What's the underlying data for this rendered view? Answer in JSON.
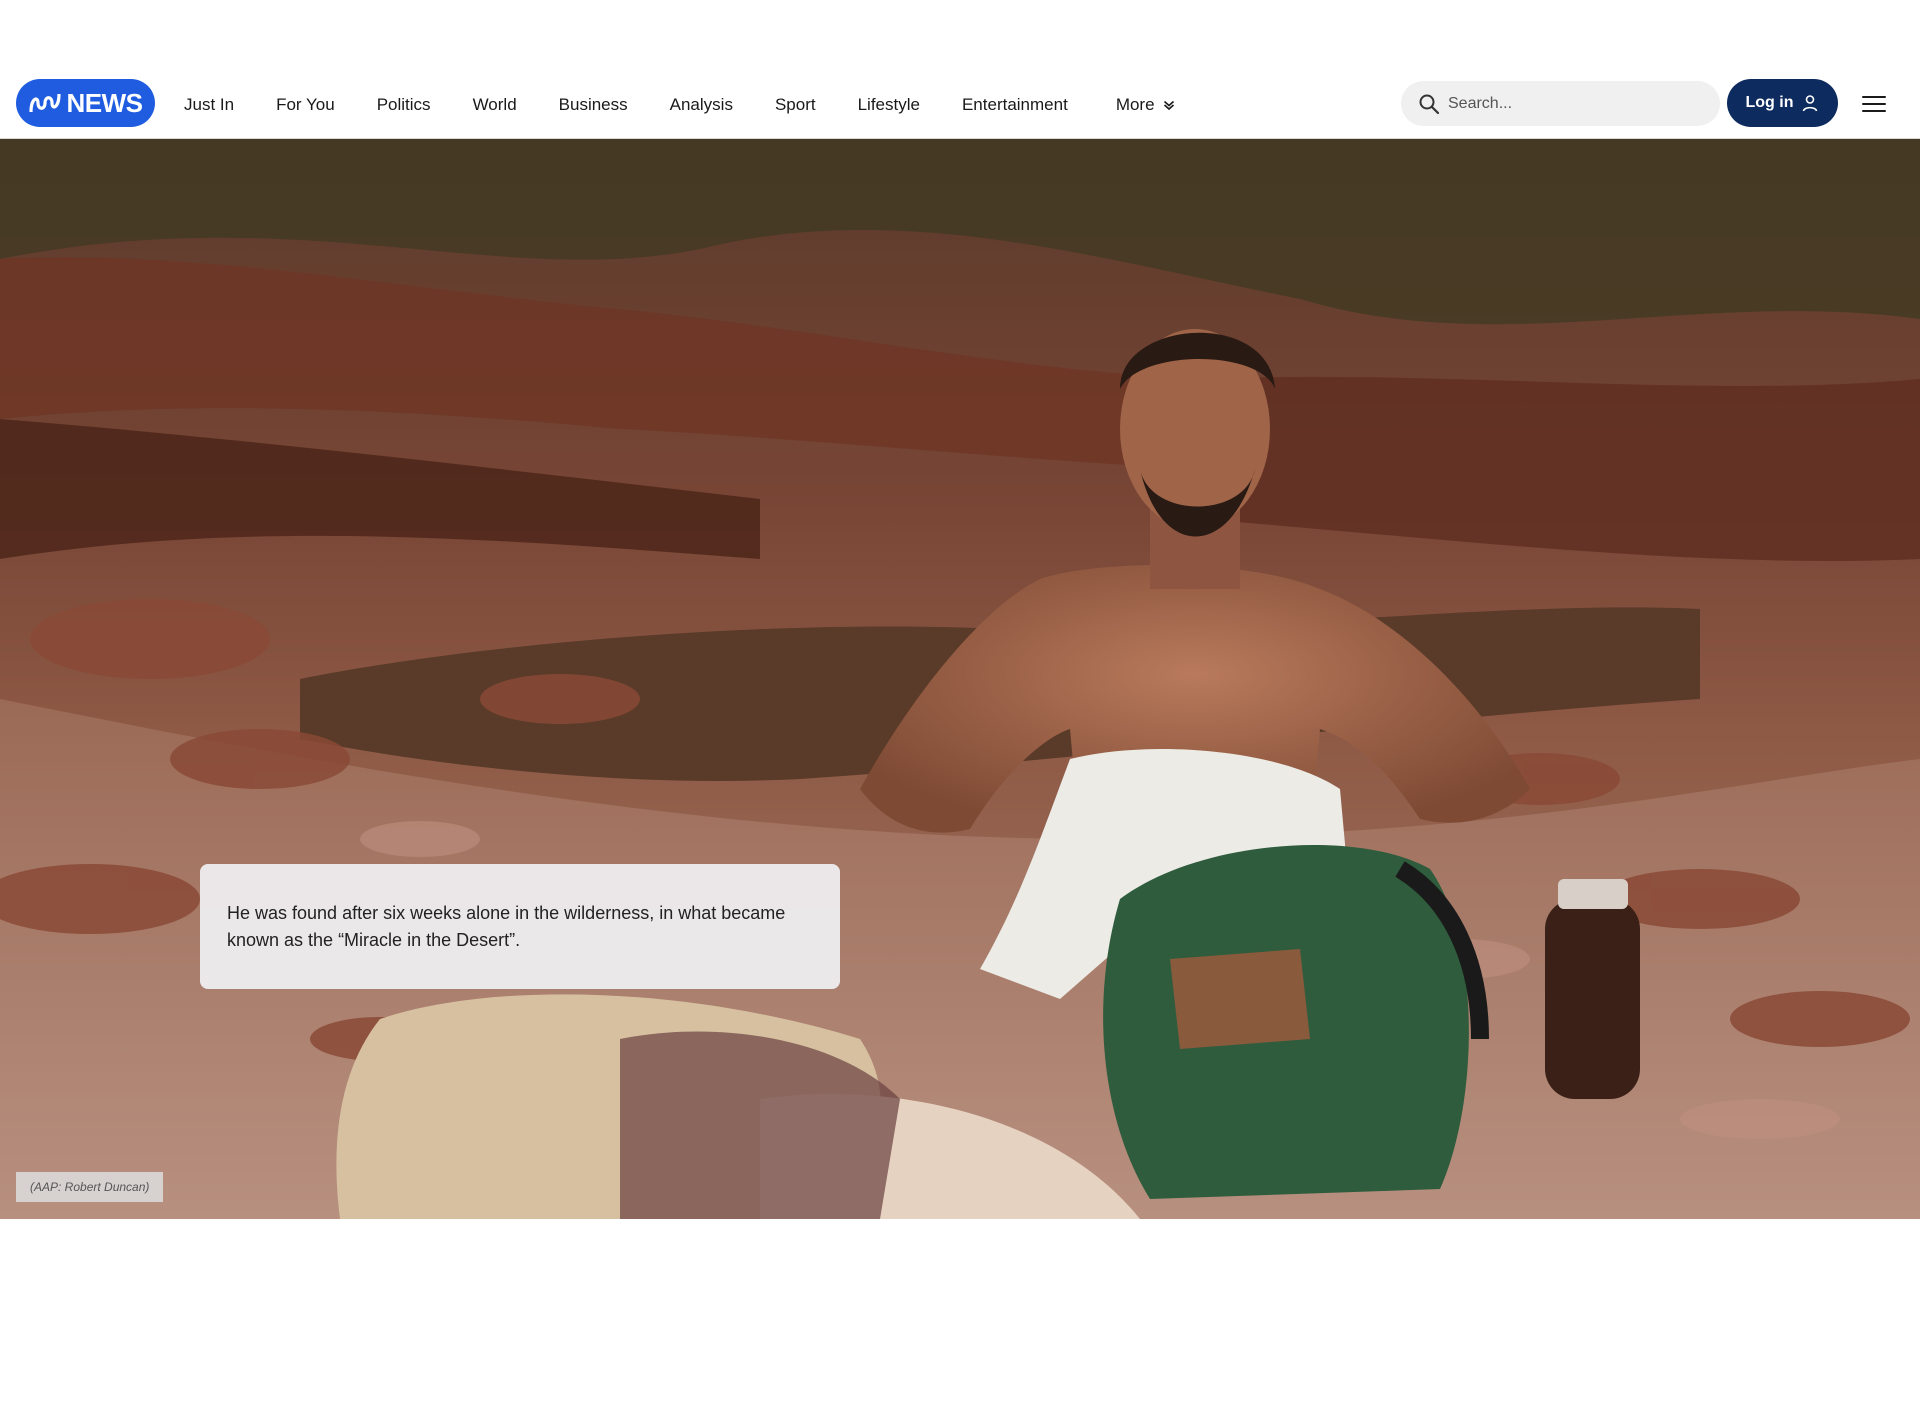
{
  "header": {
    "logo_text": "NEWS",
    "nav": [
      "Just In",
      "For You",
      "Politics",
      "World",
      "Business",
      "Analysis",
      "Sport",
      "Lifestyle",
      "Entertainment"
    ],
    "more_label": "More",
    "search_placeholder": "Search...",
    "login_label": "Log in",
    "colors": {
      "logo_bg": "#1f5ce0",
      "login_bg": "#0d2b5e"
    }
  },
  "hero": {
    "caption": "He was found after six weeks alone in the wilderness, in what became known as the “Miracle in the Desert”.",
    "credit": "(AAP: Robert Duncan)"
  },
  "icons": [
    "abc-logo-icon",
    "chevron-down-icon",
    "search-icon",
    "user-icon",
    "hamburger-menu-icon"
  ]
}
